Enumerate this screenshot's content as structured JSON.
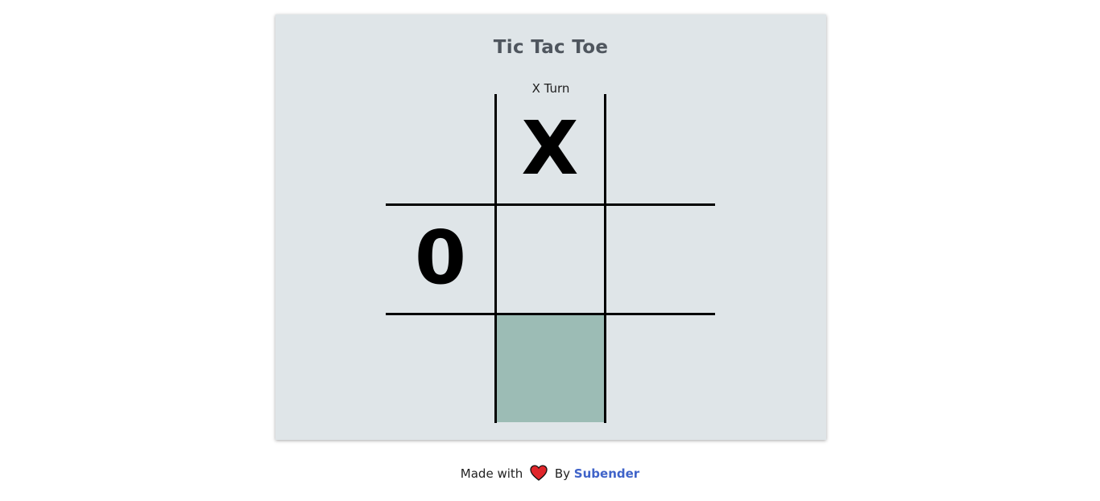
{
  "game": {
    "title": "Tic Tac Toe",
    "turn_text": "X Turn"
  },
  "board": {
    "cells": [
      "",
      "X",
      "",
      "0",
      "",
      "",
      "",
      "",
      ""
    ],
    "highlighted_cell_index": 7
  },
  "footer": {
    "made_with": "Made with",
    "by": "By",
    "author": "Subender"
  },
  "colors": {
    "card_background": "#dfe5e8",
    "highlight": "#9cbcb5",
    "author_link": "#3f63c9",
    "title": "#4f565e",
    "heart": "#e0262b"
  },
  "icons": {
    "heart": "heart-icon"
  }
}
